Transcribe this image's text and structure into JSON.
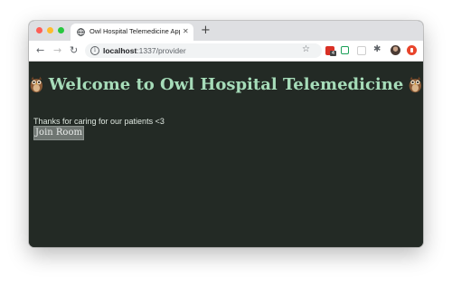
{
  "browser": {
    "tab_title": "Owl Hospital Telemedicine App",
    "url_host": "localhost",
    "url_path": ":1337/provider",
    "ext_badge": "4"
  },
  "page": {
    "heading": "Welcome to Owl Hospital Telemedicine",
    "subtext": "Thanks for caring for our patients <3",
    "join_button_label": "Join Room",
    "colors": {
      "background": "#232a25",
      "heading": "#a6dcb9",
      "button": "#6f7672"
    },
    "icons": [
      "owl-emoji-icon"
    ]
  }
}
